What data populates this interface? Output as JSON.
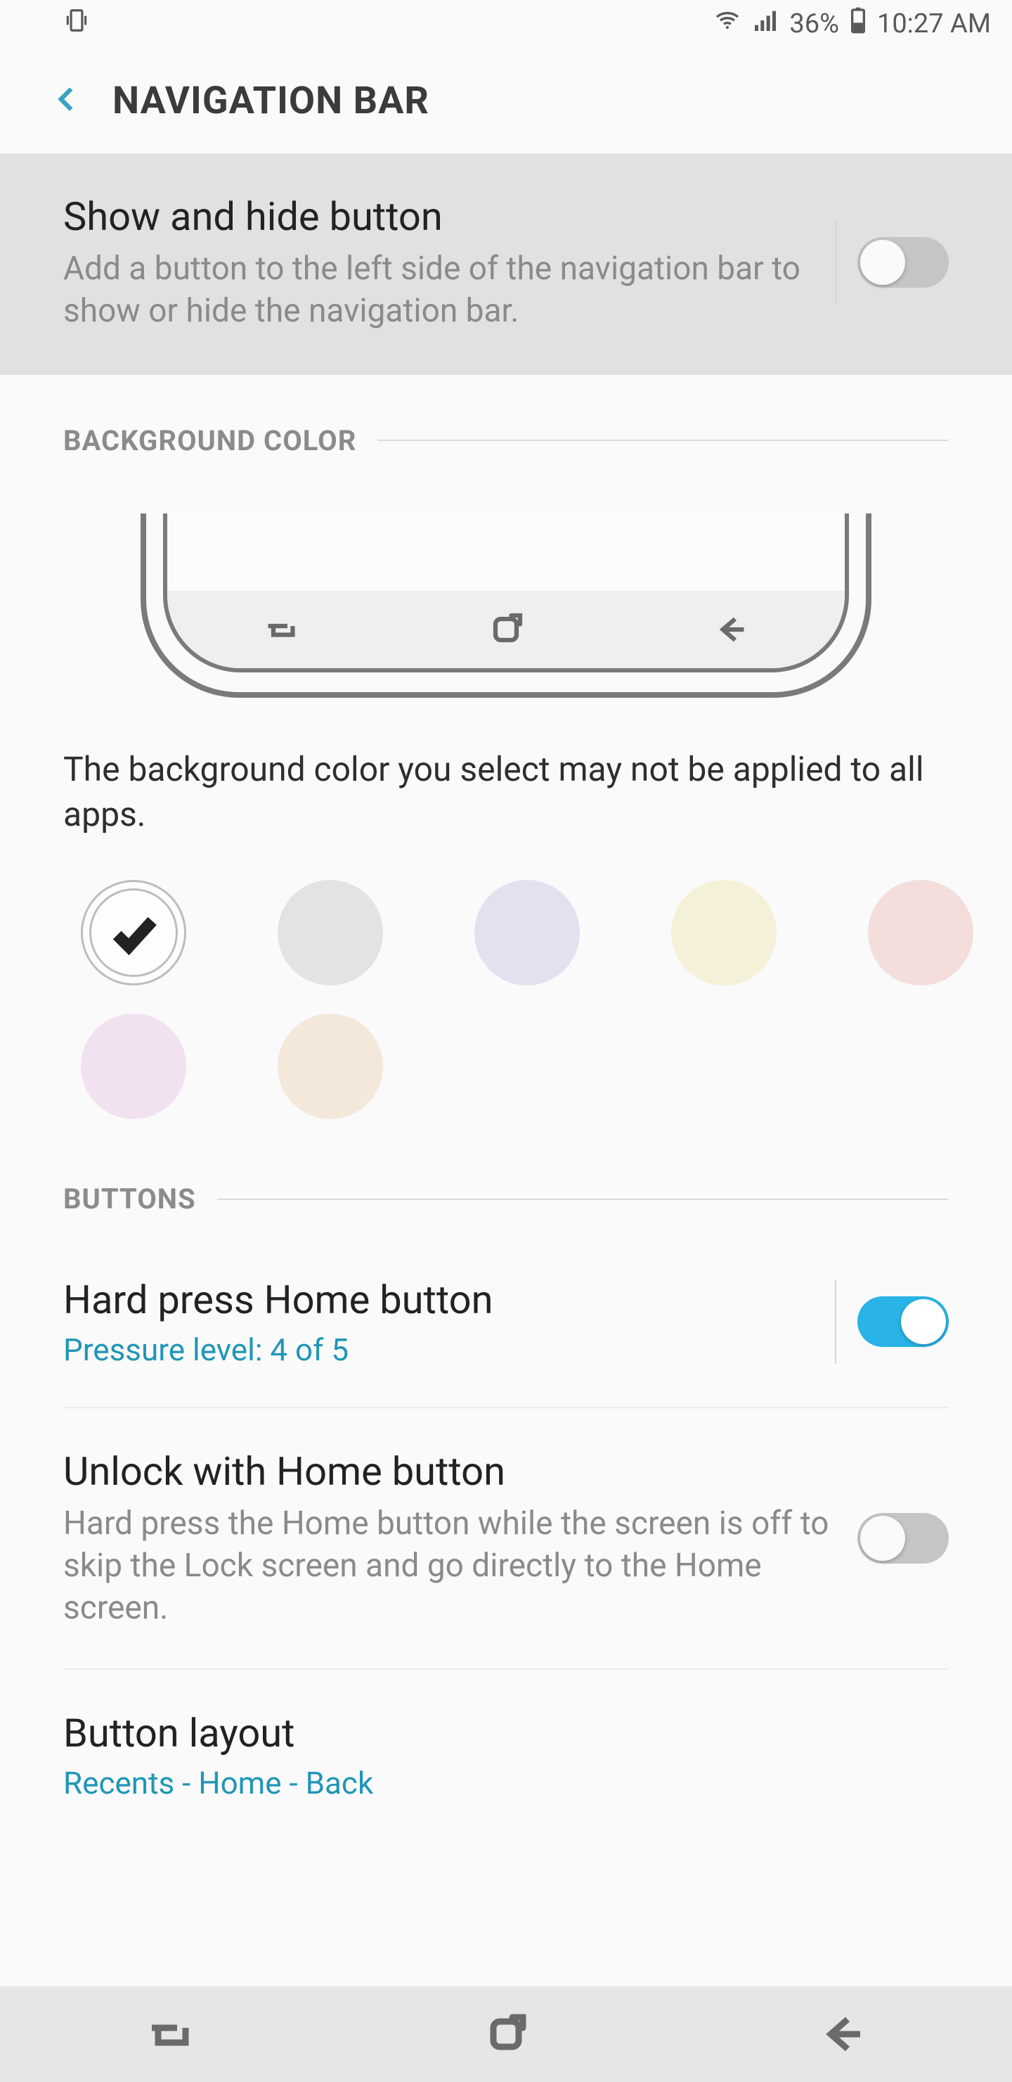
{
  "statusbar": {
    "battery_pct": "36%",
    "clock": "10:27 AM"
  },
  "appbar": {
    "title": "NAVIGATION BAR"
  },
  "show_hide": {
    "title": "Show and hide button",
    "desc": "Add a button to the left side of the navigation bar to show or hide the navigation bar.",
    "enabled": false
  },
  "sections": {
    "bg_color_header": "BACKGROUND COLOR",
    "buttons_header": "BUTTONS"
  },
  "bg_color": {
    "desc": "The background color you select may not be applied to all apps.",
    "swatches": [
      {
        "id": "white",
        "hex": "#fdfdfd",
        "selected": true
      },
      {
        "id": "gray",
        "hex": "#e3e3e3",
        "selected": false
      },
      {
        "id": "lilac",
        "hex": "#e1e1f0",
        "selected": false
      },
      {
        "id": "cream",
        "hex": "#f4f1d8",
        "selected": false
      },
      {
        "id": "blush",
        "hex": "#f3dedb",
        "selected": false
      },
      {
        "id": "pink",
        "hex": "#f2e1f0",
        "selected": false
      },
      {
        "id": "peach",
        "hex": "#f4e8da",
        "selected": false
      }
    ]
  },
  "buttons": {
    "hard_press": {
      "title": "Hard press Home button",
      "sub": "Pressure level: 4 of 5",
      "enabled": true
    },
    "unlock": {
      "title": "Unlock with Home button",
      "desc": "Hard press the Home button while the screen is off to skip the Lock screen and go directly to the Home screen.",
      "enabled": false
    },
    "layout": {
      "title": "Button layout",
      "sub": "Recents - Home - Back"
    }
  }
}
